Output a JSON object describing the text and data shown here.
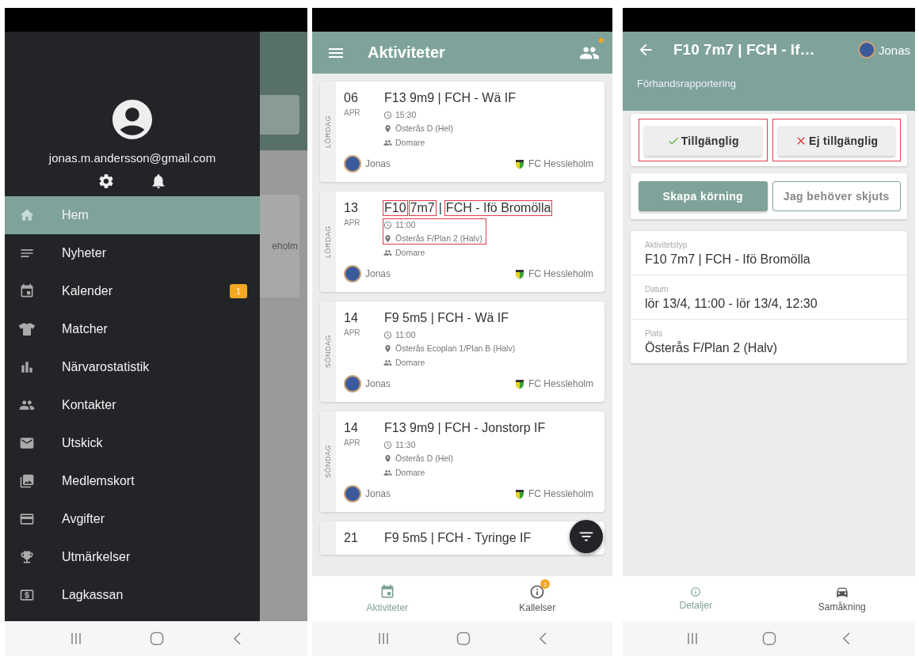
{
  "drawer_screen": {
    "email": "jonas.m.andersson@gmail.com",
    "backdrop_text": "eholm",
    "menu": [
      {
        "label": "Hem",
        "selected": true
      },
      {
        "label": "Nyheter",
        "selected": false
      },
      {
        "label": "Kalender",
        "selected": false,
        "badge": "1"
      },
      {
        "label": "Matcher",
        "selected": false
      },
      {
        "label": "Närvarostatistik",
        "selected": false
      },
      {
        "label": "Kontakter",
        "selected": false
      },
      {
        "label": "Utskick",
        "selected": false
      },
      {
        "label": "Medlemskort",
        "selected": false
      },
      {
        "label": "Avgifter",
        "selected": false
      },
      {
        "label": "Utmärkelser",
        "selected": false
      },
      {
        "label": "Lagkassan",
        "selected": false
      }
    ]
  },
  "activities_screen": {
    "title": "Aktiviteter",
    "notification_dot": true,
    "cards": [
      {
        "day": "06",
        "month": "APR",
        "weekday": "LÖRDAG",
        "title_parts": [
          {
            "text": "F13 9m9 | FCH - Wä IF",
            "highlighted": false
          }
        ],
        "time": "15:30",
        "place": "Österås D (Hel)",
        "role": "Domare",
        "player": "Jonas",
        "club": "FC Hessleholm",
        "details_highlighted": false
      },
      {
        "day": "13",
        "month": "APR",
        "weekday": "LÖRDAG",
        "title_parts": [
          {
            "text": "F10",
            "highlighted": true
          },
          {
            "text": "7m7",
            "highlighted": true
          },
          {
            "text": "|",
            "highlighted": false
          },
          {
            "text": "FCH - Ifö Bromölla",
            "highlighted": true
          }
        ],
        "time": "11:00",
        "place": "Österås F/Plan 2 (Halv)",
        "role": "Domare",
        "player": "Jonas",
        "club": "FC Hessleholm",
        "details_highlighted": true
      },
      {
        "day": "14",
        "month": "APR",
        "weekday": "SÖNDAG",
        "title_parts": [
          {
            "text": "F9 5m5 | FCH - Wä IF",
            "highlighted": false
          }
        ],
        "time": "11:00",
        "place": "Österås Ecoplan 1/Plan B (Halv)",
        "role": "Domare",
        "player": "Jonas",
        "club": "FC Hessleholm",
        "details_highlighted": false
      },
      {
        "day": "14",
        "month": "APR",
        "weekday": "SÖNDAG",
        "title_parts": [
          {
            "text": "F13 9m9 | FCH - Jonstorp IF",
            "highlighted": false
          }
        ],
        "time": "11:30",
        "place": "Österås D (Hel)",
        "role": "Domare",
        "player": "Jonas",
        "club": "FC Hessleholm",
        "details_highlighted": false
      },
      {
        "day": "21",
        "title_parts": [
          {
            "text": "F9 5m5 | FCH - Tyringe IF",
            "highlighted": false
          }
        ]
      }
    ],
    "tabs": [
      {
        "label": "Aktiviteter",
        "selected": true
      },
      {
        "label": "Kallelser",
        "selected": false,
        "badge": "1"
      }
    ]
  },
  "detail_screen": {
    "title": "F10 7m7 | FCH - If…",
    "user": "Jonas",
    "subtitle": "Förhandsrapportering",
    "availability": [
      {
        "kind": "yes",
        "label": "Tillgänglig",
        "highlighted": true
      },
      {
        "kind": "no",
        "label": "Ej tillgänglig",
        "highlighted": true
      }
    ],
    "carpool_buttons": [
      {
        "kind": "filled",
        "label": "Skapa körning"
      },
      {
        "kind": "outlined",
        "label": "Jag behöver skjuts"
      }
    ],
    "fields": [
      {
        "label": "Aktivitetstyp",
        "value": "F10 7m7 | FCH - Ifö Bromölla"
      },
      {
        "label": "Datum",
        "value": "lör 13/4, 11:00 - lör 13/4, 12:30"
      },
      {
        "label": "Plats",
        "value": "Österås F/Plan 2 (Halv)"
      }
    ],
    "tabs": [
      {
        "label": "Detaljer",
        "selected": true
      },
      {
        "label": "Samåkning",
        "selected": false
      }
    ]
  }
}
